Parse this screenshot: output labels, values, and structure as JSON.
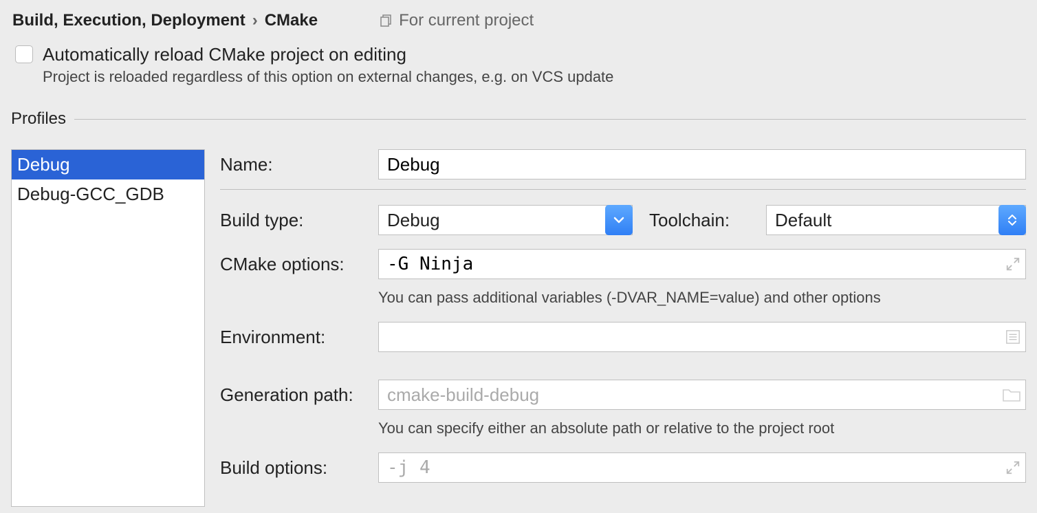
{
  "breadcrumb": {
    "parent": "Build, Execution, Deployment",
    "current": "CMake",
    "scope": "For current project"
  },
  "autoReload": {
    "label": "Automatically reload CMake project on editing",
    "description": "Project is reloaded regardless of this option on external changes, e.g. on VCS update"
  },
  "profilesTitle": "Profiles",
  "profiles": [
    "Debug",
    "Debug-GCC_GDB"
  ],
  "form": {
    "nameLabel": "Name:",
    "nameValue": "Debug",
    "buildTypeLabel": "Build type:",
    "buildTypeValue": "Debug",
    "toolchainLabel": "Toolchain:",
    "toolchainValue": "Default",
    "cmakeOptionsLabel": "CMake options:",
    "cmakeOptionsValue": "-G Ninja",
    "cmakeOptionsHint": "You can pass additional variables (-DVAR_NAME=value) and other options",
    "envLabel": "Environment:",
    "envValue": "",
    "genPathLabel": "Generation path:",
    "genPathPlaceholder": "cmake-build-debug",
    "genPathHint": "You can specify either an absolute path or relative to the project root",
    "buildOptionsLabel": "Build options:",
    "buildOptionsPlaceholder": "-j 4"
  }
}
